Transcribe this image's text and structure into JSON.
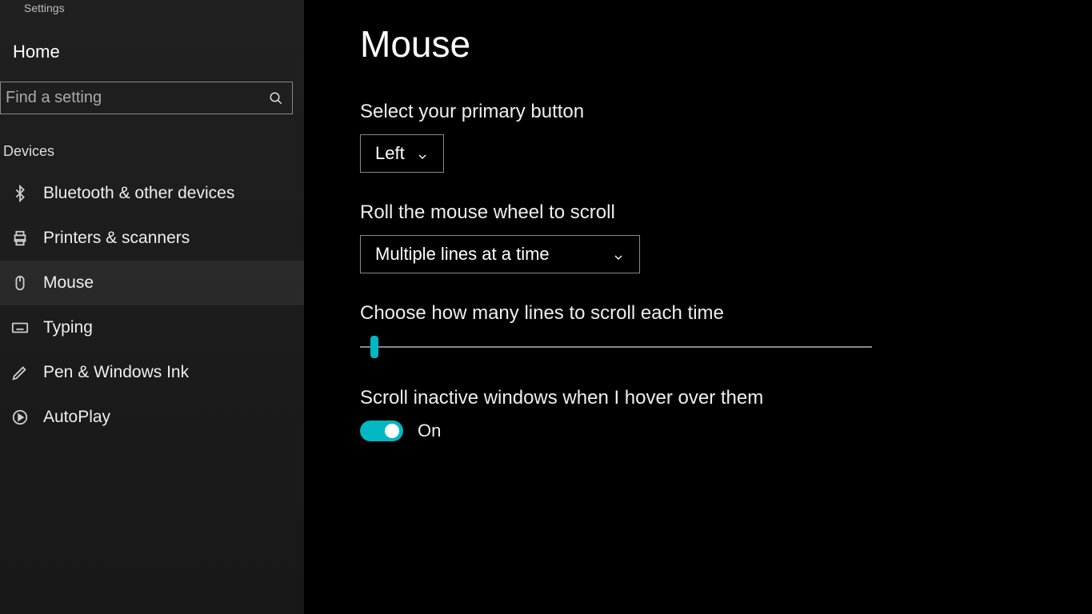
{
  "app": {
    "title": "Settings"
  },
  "sidebar": {
    "home": "Home",
    "search_placeholder": "Find a setting",
    "section": "Devices",
    "items": [
      {
        "label": "Bluetooth & other devices"
      },
      {
        "label": "Printers & scanners"
      },
      {
        "label": "Mouse"
      },
      {
        "label": "Typing"
      },
      {
        "label": "Pen & Windows Ink"
      },
      {
        "label": "AutoPlay"
      }
    ]
  },
  "main": {
    "title": "Mouse",
    "primary_button": {
      "label": "Select your primary button",
      "value": "Left"
    },
    "wheel_scroll": {
      "label": "Roll the mouse wheel to scroll",
      "value": "Multiple lines at a time"
    },
    "lines_slider": {
      "label": "Choose how many lines to scroll each time"
    },
    "inactive_scroll": {
      "label": "Scroll inactive windows when I hover over them",
      "state": "On"
    }
  },
  "colors": {
    "accent": "#00b7c3"
  }
}
